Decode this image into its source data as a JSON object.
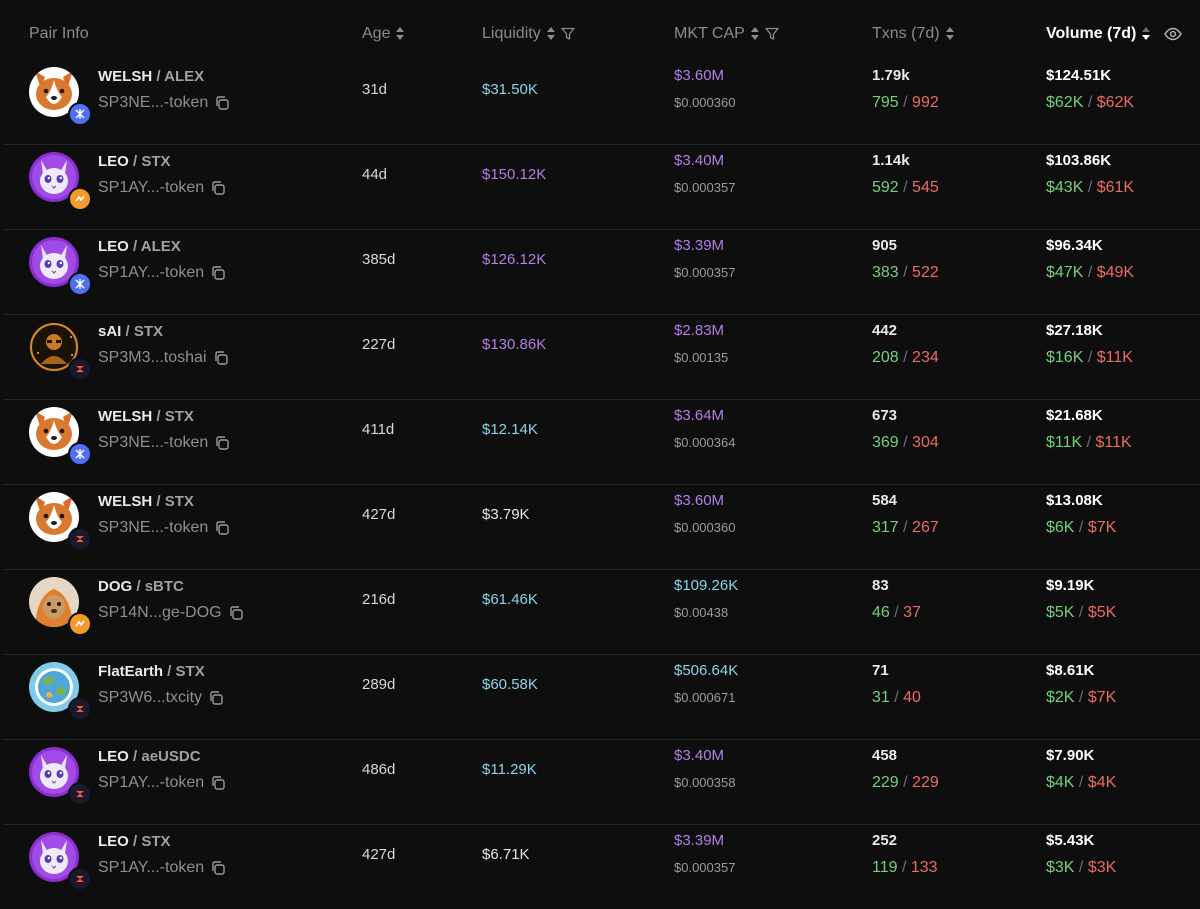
{
  "header": {
    "pair_info": "Pair Info",
    "age": "Age",
    "liquidity": "Liquidity",
    "mkt_cap": "MKT CAP",
    "txns": "Txns (7d)",
    "volume": "Volume (7d)"
  },
  "colors": {
    "cyan": "#8ad4e8",
    "purple": "#b27ee8",
    "white": "#e6e6e6",
    "buy": "#73d17a",
    "sell": "#ea6b63"
  },
  "rows": [
    {
      "token": "WELSH",
      "quote": "ALEX",
      "address": "SP3NE...-token",
      "avatar": "welsh-icon",
      "badge": "alex",
      "age": "31d",
      "liquidity": "$31.50K",
      "liq_color": "cyan",
      "mkt_cap": "$3.60M",
      "cap_color": "purple",
      "price": "$0.000360",
      "txns": "1.79k",
      "buys": "795",
      "sells": "992",
      "volume": "$124.51K",
      "buy_vol": "$62K",
      "sell_vol": "$62K"
    },
    {
      "token": "LEO",
      "quote": "STX",
      "address": "SP1AY...-token",
      "avatar": "leo-icon",
      "badge": "orange",
      "age": "44d",
      "liquidity": "$150.12K",
      "liq_color": "purple",
      "mkt_cap": "$3.40M",
      "cap_color": "purple",
      "price": "$0.000357",
      "txns": "1.14k",
      "buys": "592",
      "sells": "545",
      "volume": "$103.86K",
      "buy_vol": "$43K",
      "sell_vol": "$61K"
    },
    {
      "token": "LEO",
      "quote": "ALEX",
      "address": "SP1AY...-token",
      "avatar": "leo-icon",
      "badge": "alex",
      "age": "385d",
      "liquidity": "$126.12K",
      "liq_color": "purple",
      "mkt_cap": "$3.39M",
      "cap_color": "purple",
      "price": "$0.000357",
      "txns": "905",
      "buys": "383",
      "sells": "522",
      "volume": "$96.34K",
      "buy_vol": "$47K",
      "sell_vol": "$49K"
    },
    {
      "token": "sAI",
      "quote": "STX",
      "address": "SP3M3...toshai",
      "avatar": "sai-icon",
      "badge": "stx",
      "age": "227d",
      "liquidity": "$130.86K",
      "liq_color": "purple",
      "mkt_cap": "$2.83M",
      "cap_color": "purple",
      "price": "$0.00135",
      "txns": "442",
      "buys": "208",
      "sells": "234",
      "volume": "$27.18K",
      "buy_vol": "$16K",
      "sell_vol": "$11K"
    },
    {
      "token": "WELSH",
      "quote": "STX",
      "address": "SP3NE...-token",
      "avatar": "welsh-icon",
      "badge": "alex",
      "age": "411d",
      "liquidity": "$12.14K",
      "liq_color": "cyan",
      "mkt_cap": "$3.64M",
      "cap_color": "purple",
      "price": "$0.000364",
      "txns": "673",
      "buys": "369",
      "sells": "304",
      "volume": "$21.68K",
      "buy_vol": "$11K",
      "sell_vol": "$11K"
    },
    {
      "token": "WELSH",
      "quote": "STX",
      "address": "SP3NE...-token",
      "avatar": "welsh-icon",
      "badge": "stx",
      "age": "427d",
      "liquidity": "$3.79K",
      "liq_color": "white",
      "mkt_cap": "$3.60M",
      "cap_color": "purple",
      "price": "$0.000360",
      "txns": "584",
      "buys": "317",
      "sells": "267",
      "volume": "$13.08K",
      "buy_vol": "$6K",
      "sell_vol": "$7K"
    },
    {
      "token": "DOG",
      "quote": "sBTC",
      "address": "SP14N...ge-DOG",
      "avatar": "dog-icon",
      "badge": "orange",
      "age": "216d",
      "liquidity": "$61.46K",
      "liq_color": "cyan",
      "mkt_cap": "$109.26K",
      "cap_color": "cyan",
      "price": "$0.00438",
      "txns": "83",
      "buys": "46",
      "sells": "37",
      "volume": "$9.19K",
      "buy_vol": "$5K",
      "sell_vol": "$5K"
    },
    {
      "token": "FlatEarth",
      "quote": "STX",
      "address": "SP3W6...txcity",
      "avatar": "flatearth-icon",
      "badge": "stx",
      "age": "289d",
      "liquidity": "$60.58K",
      "liq_color": "cyan",
      "mkt_cap": "$506.64K",
      "cap_color": "cyan",
      "price": "$0.000671",
      "txns": "71",
      "buys": "31",
      "sells": "40",
      "volume": "$8.61K",
      "buy_vol": "$2K",
      "sell_vol": "$7K"
    },
    {
      "token": "LEO",
      "quote": "aeUSDC",
      "address": "SP1AY...-token",
      "avatar": "leo-icon",
      "badge": "stx",
      "age": "486d",
      "liquidity": "$11.29K",
      "liq_color": "cyan",
      "mkt_cap": "$3.40M",
      "cap_color": "purple",
      "price": "$0.000358",
      "txns": "458",
      "buys": "229",
      "sells": "229",
      "volume": "$7.90K",
      "buy_vol": "$4K",
      "sell_vol": "$4K"
    },
    {
      "token": "LEO",
      "quote": "STX",
      "address": "SP1AY...-token",
      "avatar": "leo-icon",
      "badge": "stx",
      "age": "427d",
      "liquidity": "$6.71K",
      "liq_color": "white",
      "mkt_cap": "$3.39M",
      "cap_color": "purple",
      "price": "$0.000357",
      "txns": "252",
      "buys": "119",
      "sells": "133",
      "volume": "$5.43K",
      "buy_vol": "$3K",
      "sell_vol": "$3K"
    }
  ]
}
